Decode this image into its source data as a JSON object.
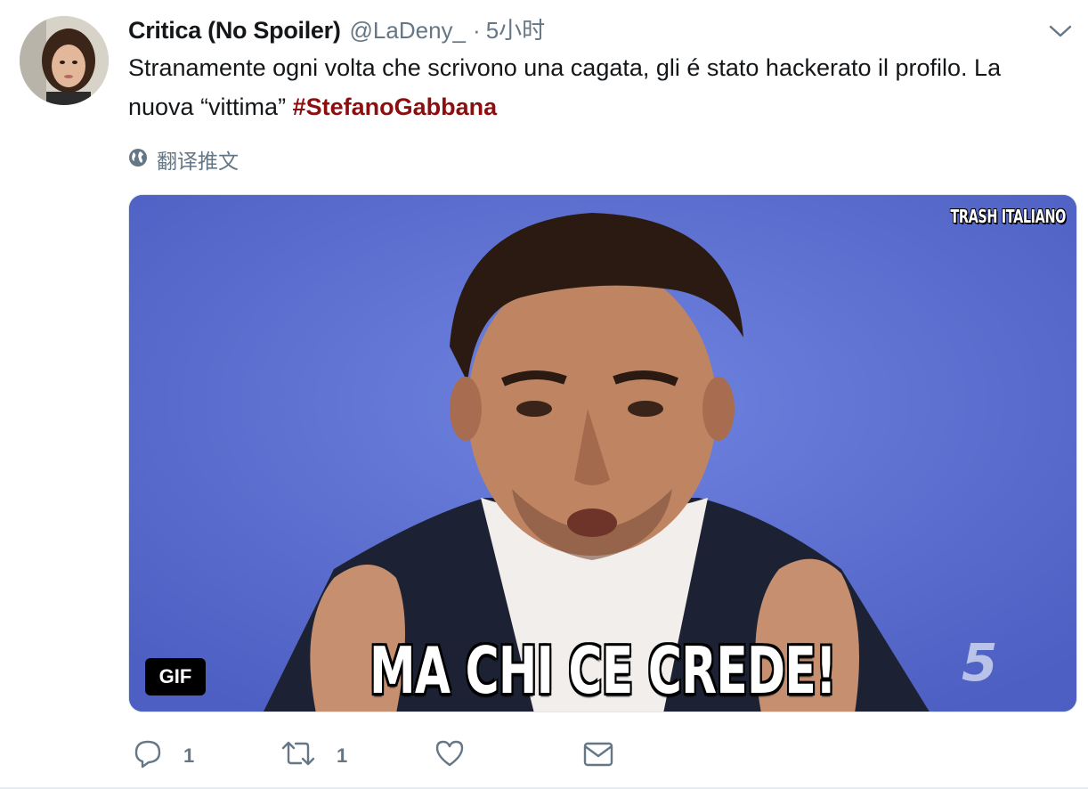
{
  "tweet": {
    "display_name": "Critica (No Spoiler)",
    "handle": "@LaDeny_",
    "separator": "·",
    "time": "5小时",
    "text_plain": "Stranamente ogni volta che scrivono una cagata, gli é stato hackerato il profilo. La nuova “vittima” ",
    "hashtag": "#StefanoGabbana",
    "translate_label": "翻译推文"
  },
  "media": {
    "watermark": "TRASH ITALIANO",
    "caption": "MA CHI CE CREDE!",
    "badge": "GIF",
    "channel_logo": "5"
  },
  "actions": {
    "reply_count": "1",
    "retweet_count": "1"
  },
  "icons": [
    "chevron-down-icon",
    "globe-icon",
    "reply-icon",
    "retweet-icon",
    "heart-icon",
    "mail-icon"
  ],
  "colors": {
    "hashtag": "#8b0f10",
    "secondary_text": "#657786",
    "media_background": "#5c6fd0"
  }
}
